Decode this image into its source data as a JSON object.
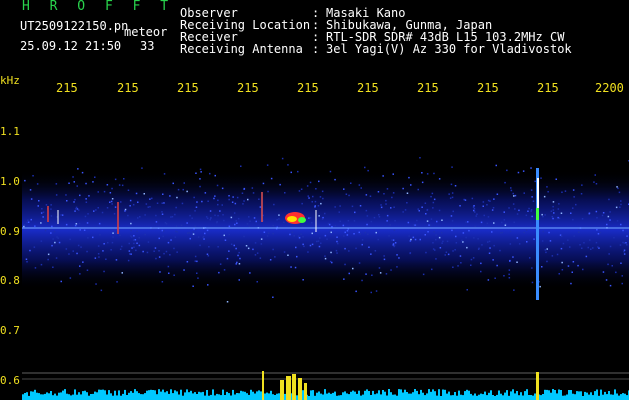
{
  "header": {
    "logo": "H R O F F T",
    "filename": "UT2509122150.pn",
    "tag": "meteor",
    "datetime": "25.09.12 21:50",
    "count": "33"
  },
  "info": [
    {
      "label": "Observer",
      "value": "Masaki Kano"
    },
    {
      "label": "Receiving Location",
      "value": "Shibukawa, Gunma, Japan"
    },
    {
      "label": "Receiver",
      "value": "RTL-SDR SDR# 43dB L15 103.2MHz CW"
    },
    {
      "label": "Receiving Antenna",
      "value": "3el Yagi(V) Az 330 for Vladivostok"
    }
  ],
  "axes": {
    "y_unit": "kHz",
    "x_ticks": [
      "215",
      "215",
      "215",
      "215",
      "215",
      "215",
      "215",
      "215",
      "215",
      "2200"
    ],
    "y_ticks": [
      "1.1",
      "1.0",
      "0.9",
      "0.8",
      "0.7",
      "0.6"
    ]
  },
  "colors": {
    "background": "#000000",
    "header_text": "#ffffff",
    "logo": "#29d44d",
    "axis_text": "#f0e020",
    "noise_band": "#1428c8",
    "signal": "#ffffff",
    "strip": "#00c8ff",
    "strip_peak": "#f0e020"
  }
}
